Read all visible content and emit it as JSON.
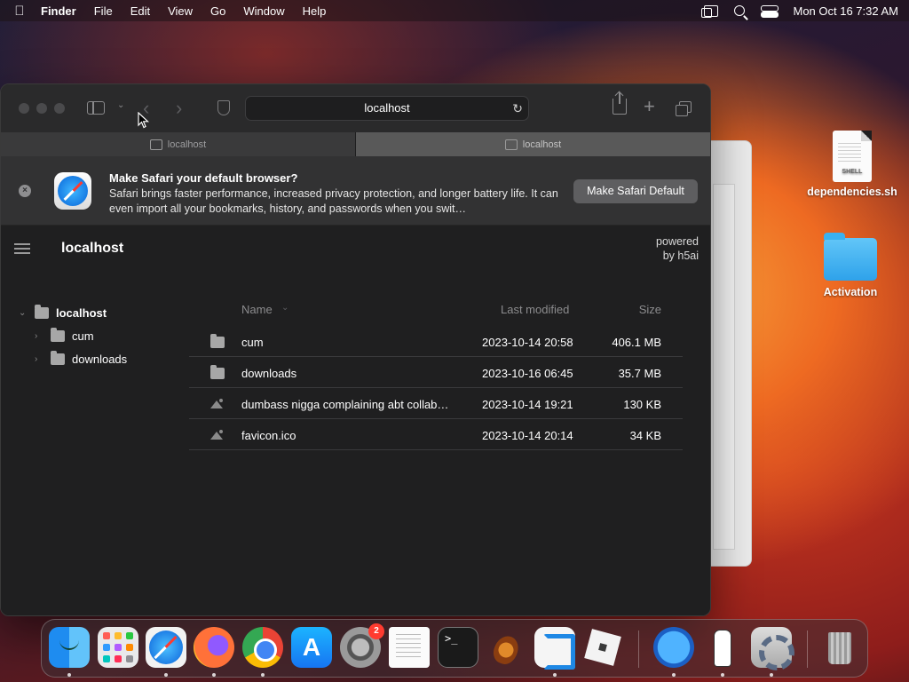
{
  "menubar": {
    "app_name": "Finder",
    "items": [
      "File",
      "Edit",
      "View",
      "Go",
      "Window",
      "Help"
    ],
    "clock": "Mon Oct 16  7:32 AM"
  },
  "safari": {
    "url": "localhost",
    "tabs": [
      {
        "label": "localhost",
        "active": false
      },
      {
        "label": "localhost",
        "active": true
      }
    ],
    "banner": {
      "title": "Make Safari your default browser?",
      "text": "Safari brings faster performance, increased privacy protection, and longer battery life. It can even import all your bookmarks, history, and passwords when you swit…",
      "button": "Make Safari Default"
    },
    "page": {
      "site_title": "localhost",
      "powered_line1": "powered",
      "powered_line2": "by h5ai",
      "tree": {
        "root": "localhost",
        "children": [
          "cum",
          "downloads"
        ]
      },
      "columns": {
        "name": "Name",
        "modified": "Last modified",
        "size": "Size"
      },
      "rows": [
        {
          "name": "cum",
          "modified": "2023-10-14 20:58",
          "size": "406.1 MB",
          "type": "folder"
        },
        {
          "name": "downloads",
          "modified": "2023-10-16 06:45",
          "size": "35.7 MB",
          "type": "folder"
        },
        {
          "name": "dumbass nigga complaining abt collab…",
          "modified": "2023-10-14 19:21",
          "size": "130 KB",
          "type": "image"
        },
        {
          "name": "favicon.ico",
          "modified": "2023-10-14 20:14",
          "size": "34 KB",
          "type": "image"
        }
      ]
    }
  },
  "desktop": {
    "items": [
      {
        "label": "dependencies.sh",
        "badge": "SHELL"
      },
      {
        "label": "Activation"
      }
    ]
  },
  "dock": {
    "apps": [
      "Finder",
      "Launchpad",
      "Safari",
      "Firefox",
      "Chrome",
      "App Store",
      "System Preferences",
      "TextEdit",
      "Terminal",
      "GarageBand",
      "Visual Studio Code",
      "Roblox",
      "Utility",
      "Chess",
      "Settings",
      "Trash"
    ],
    "system_prefs_badge": "2",
    "terminal_prompt": ">_"
  }
}
